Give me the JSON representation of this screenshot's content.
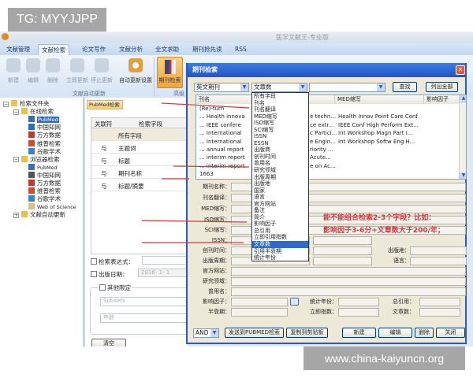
{
  "watermarks": {
    "top": "TG: MYYJJPP",
    "bottom": "www.china-kaiyuncn.org"
  },
  "app": {
    "title": "医学文献王-专业版",
    "tabs": [
      {
        "label": "文献管理"
      },
      {
        "label": "文献检索",
        "selected": true
      },
      {
        "label": "论文写作"
      },
      {
        "label": "文献分析"
      },
      {
        "label": "全文求助"
      },
      {
        "label": "期刊抢先读"
      },
      {
        "label": "RSS"
      }
    ],
    "ribbon": {
      "buttons": [
        {
          "label": "新建",
          "icon": "new-icon"
        },
        {
          "label": "编辑",
          "icon": "edit-icon"
        },
        {
          "label": "删除",
          "icon": "delete-icon"
        },
        {
          "label": "立即更新",
          "icon": "update-icon"
        },
        {
          "label": "停止更新",
          "icon": "stop-icon"
        },
        {
          "label": "自动更新设置",
          "icon": "clock-gear-icon"
        }
      ],
      "group_label": "文献自动更新",
      "journal_search": "期刊检索",
      "group2_label": "高级"
    }
  },
  "tree": [
    {
      "label": "检索文件夹",
      "level": 0,
      "toggle": "⊟"
    },
    {
      "label": "在线检索",
      "level": 1,
      "toggle": "⊟"
    },
    {
      "label": "PubMed",
      "level": 2,
      "selected": true,
      "color": "#3a6fb5"
    },
    {
      "label": "中国知网",
      "level": 2,
      "color": "#2b6cc4"
    },
    {
      "label": "万方数据",
      "level": 2,
      "color": "#c0392b"
    },
    {
      "label": "维普检索",
      "level": 2,
      "color": "#d64a2a"
    },
    {
      "label": "谷歌学术",
      "level": 2,
      "color": "#3b82c4"
    },
    {
      "label": "浏览器检索",
      "level": 1,
      "toggle": "⊟"
    },
    {
      "label": "PubMed",
      "level": 2,
      "color": "#3a6fb5"
    },
    {
      "label": "中国知网",
      "level": 2,
      "color": "#555"
    },
    {
      "label": "万方数据",
      "level": 2,
      "color": "#c0392b"
    },
    {
      "label": "维普检索",
      "level": 2,
      "color": "#d64a2a"
    },
    {
      "label": "谷歌学术",
      "level": 2,
      "color": "#3b82c4"
    },
    {
      "label": "Web of Science",
      "level": 2,
      "color": "#e0c080"
    },
    {
      "label": "文献自动更新",
      "level": 1,
      "toggle": "⊞"
    }
  ],
  "pubmed": {
    "tab": "PubMed检索",
    "col_op": "关联符",
    "col_field": "检索字段",
    "rows": [
      {
        "op": "",
        "field": "所有字段"
      },
      {
        "op": "与",
        "field": "主题词"
      },
      {
        "op": "与",
        "field": "标题"
      },
      {
        "op": "与",
        "field": "期刊名称"
      },
      {
        "op": "与",
        "field": "标题/摘要"
      }
    ],
    "expr_label": "检索表达式：",
    "date_label": "出版日期：",
    "date_value": "2016- 1- 1",
    "other_label": "其他限定",
    "subsets": "Subsets",
    "age": "年龄",
    "clear": "清空"
  },
  "dialog": {
    "title": "期刊检索",
    "db_select": "英文期刊",
    "field_select": "文章数",
    "value_select": "",
    "find": "查找",
    "list_all": "列出全部",
    "columns": [
      "刊名",
      "MED缩写",
      "影响因子"
    ],
    "rows": [
      {
        "name": "(Re)-turn",
        "c2": "",
        "med": ""
      },
      {
        "name": "... Health innova",
        "c2": "e techn...",
        "med": "Health Innov Point Care Conf"
      },
      {
        "name": "... IEEE confere",
        "c2": "ce extr...",
        "med": "IEEE Conf High Perform Ext..."
      },
      {
        "name": "... International",
        "c2": "c Particl...",
        "med": "Int Workshop Magn Part I..."
      },
      {
        "name": "... International",
        "c2": "e Engin...",
        "med": "Int Workshop Softw Eng H..."
      },
      {
        "name": "... annual report",
        "c2": "riority ...",
        "med": ""
      },
      {
        "name": "... interim report",
        "c2": "Acute...",
        "med": ""
      },
      {
        "name": "... interim report",
        "c2": "e on Ac...",
        "med": ""
      },
      {
        "name": "1663",
        "c2": "",
        "med": ""
      }
    ],
    "dropdown": {
      "selected": "文章数",
      "items": [
        "所有字段",
        "刊名",
        "刊名翻译",
        "MED缩写",
        "ISO缩写",
        "SCI缩写",
        "ISSN",
        "ESSN",
        "出版商",
        "创刊时间",
        "曾用名",
        "研究领域",
        "出版周期",
        "出版地",
        "国家",
        "语言",
        "官方网站",
        "备注",
        "简介",
        "影响因子",
        "总引用",
        "立即引用指数",
        "文章数",
        "引用半衰期",
        "统计年份"
      ]
    },
    "form": {
      "labels": [
        "期刊名称：",
        "刊名翻译：",
        "MED缩写：",
        "ISO缩写：",
        "SCI缩写：",
        "ISSN：",
        "创刊时间：",
        "出版周期：",
        "官方网站：",
        "研究领域：",
        "曾用名：",
        "影响因子：",
        "半衰期："
      ],
      "publish_place": "出版地：",
      "language": "语言：",
      "stat_year": "统计年份：",
      "total_cite": "总引用：",
      "immediacy": "立即指数：",
      "article_count": "文章数："
    },
    "annotation": [
      "能不能组合检索2-3个字段？比如：",
      "影响因子3-6分+文章数大于200/年；"
    ],
    "footer": {
      "logic": "AND",
      "send": "发送到PUBMED检索",
      "copy": "复制到剪贴板",
      "new": "新建",
      "edit": "编辑",
      "delete": "删除",
      "close": "关闭"
    }
  },
  "colors": {
    "accent": "#316ac5",
    "annotation": "#d2383c",
    "dialog_title": "#1f56c6"
  }
}
